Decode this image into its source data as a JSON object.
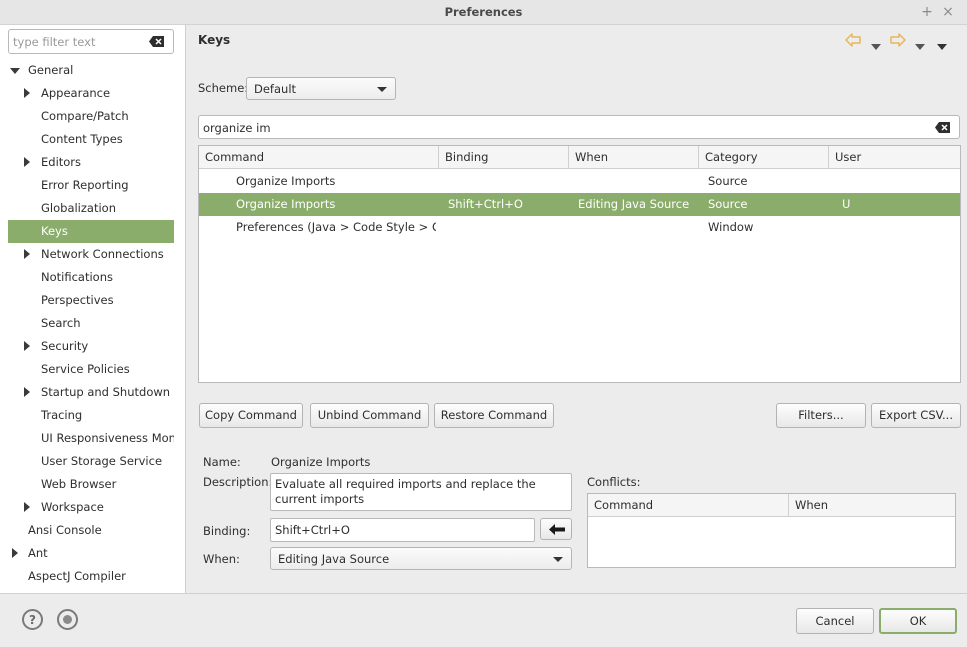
{
  "window": {
    "title": "Preferences",
    "btn_max": "+",
    "btn_close": "×"
  },
  "filter": {
    "placeholder": "type filter text"
  },
  "tree": [
    {
      "label": "General",
      "expander": "down",
      "indent": 0
    },
    {
      "label": "Appearance",
      "expander": "right",
      "indent": 1
    },
    {
      "label": "Compare/Patch",
      "expander": "",
      "indent": 1
    },
    {
      "label": "Content Types",
      "expander": "",
      "indent": 1
    },
    {
      "label": "Editors",
      "expander": "right",
      "indent": 1
    },
    {
      "label": "Error Reporting",
      "expander": "",
      "indent": 1
    },
    {
      "label": "Globalization",
      "expander": "",
      "indent": 1
    },
    {
      "label": "Keys",
      "expander": "",
      "indent": 1,
      "selected": true
    },
    {
      "label": "Network Connections",
      "expander": "right",
      "indent": 1
    },
    {
      "label": "Notifications",
      "expander": "",
      "indent": 1
    },
    {
      "label": "Perspectives",
      "expander": "",
      "indent": 1
    },
    {
      "label": "Search",
      "expander": "",
      "indent": 1
    },
    {
      "label": "Security",
      "expander": "right",
      "indent": 1
    },
    {
      "label": "Service Policies",
      "expander": "",
      "indent": 1
    },
    {
      "label": "Startup and Shutdown",
      "expander": "right",
      "indent": 1
    },
    {
      "label": "Tracing",
      "expander": "",
      "indent": 1
    },
    {
      "label": "UI Responsiveness Monito",
      "expander": "",
      "indent": 1
    },
    {
      "label": "User Storage Service",
      "expander": "",
      "indent": 1
    },
    {
      "label": "Web Browser",
      "expander": "",
      "indent": 1
    },
    {
      "label": "Workspace",
      "expander": "right",
      "indent": 1
    },
    {
      "label": "Ansi Console",
      "expander": "",
      "indent": 0
    },
    {
      "label": "Ant",
      "expander": "right",
      "indent": 0
    },
    {
      "label": "AspectJ Compiler",
      "expander": "",
      "indent": 0
    }
  ],
  "page": {
    "title": "Keys"
  },
  "scheme": {
    "label": "Scheme:",
    "value": "Default"
  },
  "search": {
    "value": "organize im"
  },
  "table": {
    "columns": [
      "Command",
      "Binding",
      "When",
      "Category",
      "User"
    ],
    "rows": [
      {
        "command": "Organize Imports",
        "binding": "",
        "when": "",
        "category": "Source",
        "user": ""
      },
      {
        "command": "Organize Imports",
        "binding": "Shift+Ctrl+O",
        "when": "Editing Java Source",
        "category": "Source",
        "user": "U",
        "selected": true
      },
      {
        "command": "Preferences (Java > Code Style > Organize Imports)",
        "binding": "",
        "when": "",
        "category": "Window",
        "user": ""
      }
    ]
  },
  "buttons": {
    "copy": "Copy Command",
    "unbind": "Unbind Command",
    "restore": "Restore Command",
    "filters": "Filters...",
    "export": "Export CSV...",
    "cancel": "Cancel",
    "ok": "OK"
  },
  "details": {
    "name_label": "Name:",
    "name_value": "Organize Imports",
    "description_label": "Description:",
    "description_value": "Evaluate all required imports and replace the current imports",
    "binding_label": "Binding:",
    "binding_value": "Shift+Ctrl+O",
    "when_label": "When:",
    "when_value": "Editing Java Source"
  },
  "conflicts": {
    "label": "Conflicts:",
    "columns": [
      "Command",
      "When"
    ]
  },
  "colors": {
    "selection": "#8bad6b",
    "arrow": "#e8b75a"
  }
}
